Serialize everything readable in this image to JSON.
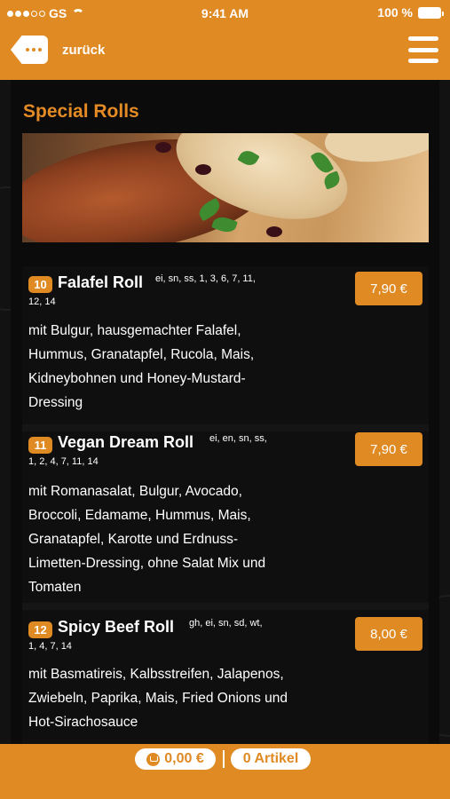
{
  "status_bar": {
    "carrier": "GS",
    "time": "9:41 AM",
    "battery": "100 %"
  },
  "header": {
    "back_label": "zurück"
  },
  "section": {
    "title": "Special Rolls"
  },
  "items": [
    {
      "number": "10",
      "name": "Falafel Roll",
      "allergens_line1": "ei, sn, ss, 1, 3, 6, 7, 11,",
      "allergens_line2": "12, 14",
      "description": "mit Bulgur, hausgemachter Falafel, Hummus, Granatapfel, Rucola, Mais, Kidneybohnen und Honey-Mustard-Dressing",
      "price": "7,90 €"
    },
    {
      "number": "11",
      "name": "Vegan Dream Roll",
      "allergens_line1": "ei, en, sn, ss,",
      "allergens_line2": "1, 2, 4, 7, 11, 14",
      "description": "mit Romanasalat, Bulgur, Avocado, Broccoli, Edamame, Hummus, Mais, Granatapfel, Karotte und Erdnuss-Limetten-Dressing, ohne Salat Mix und Tomaten",
      "price": "7,90 €"
    },
    {
      "number": "12",
      "name": "Spicy Beef Roll",
      "allergens_line1": "gh, ei, sn, sd, wt,",
      "allergens_line2": "1, 4, 7, 14",
      "description": "mit Basmatireis, Kalbsstreifen, Jalapenos, Zwiebeln, Paprika, Mais, Fried Onions und Hot-Sirachosauce",
      "price": "8,00 €"
    }
  ],
  "footer": {
    "cart_total": "0,00 €",
    "item_count": "0 Artikel"
  },
  "colors": {
    "accent": "#e08a24",
    "background": "#0b0b0b",
    "title": "#e58b25"
  }
}
